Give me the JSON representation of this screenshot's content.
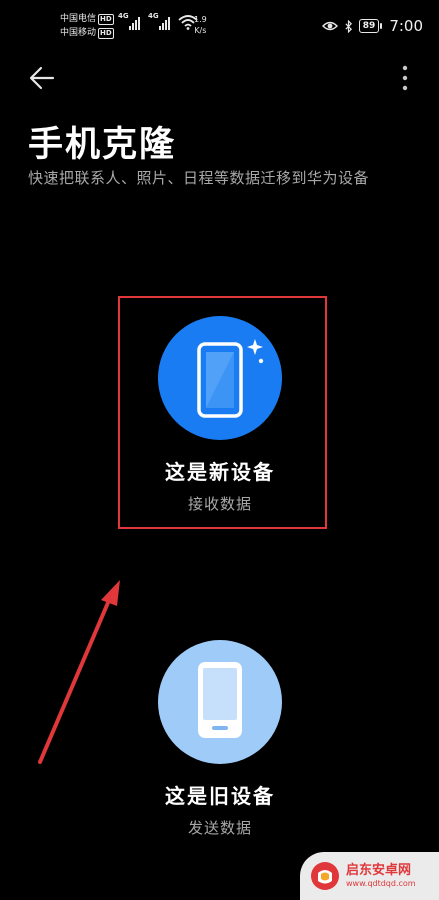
{
  "status_bar": {
    "carrier_1": "中国电信",
    "carrier_2": "中国移动",
    "hd_badge": "HD",
    "network_type": "4G",
    "speed_value": "1.9",
    "speed_unit": "K/s",
    "battery_level": "89",
    "time": "7:00"
  },
  "app_bar": {
    "back_icon": "arrow-left-icon",
    "more_icon": "more-vertical-icon"
  },
  "page": {
    "title": "手机克隆",
    "subtitle": "快速把联系人、照片、日程等数据迁移到华为设备"
  },
  "options": {
    "new_device": {
      "label": "这是新设备",
      "sub": "接收数据",
      "icon": "phone-sparkle-icon",
      "color": "#1a7cf2"
    },
    "old_device": {
      "label": "这是旧设备",
      "sub": "发送数据",
      "icon": "phone-icon",
      "color": "#9ecbf7"
    }
  },
  "annotations": {
    "highlight_color": "#e0373b"
  },
  "watermark": {
    "name": "启东安卓网",
    "url": "www.qdtdqd.com"
  }
}
